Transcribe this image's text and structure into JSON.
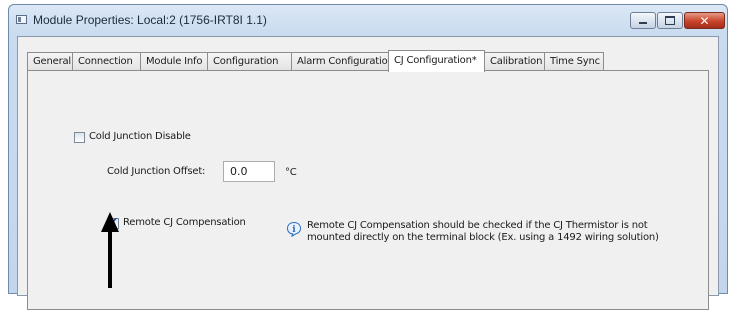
{
  "window": {
    "title": "Module Properties: Local:2 (1756-IRT8I 1.1)",
    "controls": {
      "minimize": "minimize",
      "maximize": "maximize",
      "close": "close"
    }
  },
  "tabs": [
    {
      "label": "General",
      "active": false
    },
    {
      "label": "Connection",
      "active": false
    },
    {
      "label": "Module Info",
      "active": false
    },
    {
      "label": "Configuration",
      "active": false
    },
    {
      "label": "Alarm Configuration",
      "active": false
    },
    {
      "label": "CJ Configuration*",
      "active": true
    },
    {
      "label": "Calibration",
      "active": false
    },
    {
      "label": "Time Sync",
      "active": false
    }
  ],
  "cj": {
    "disable_label": "Cold Junction Disable",
    "disable_checked": false,
    "offset_label": "Cold Junction Offset:",
    "offset_value": "0.0",
    "offset_unit": "°C",
    "remote_label": "Remote CJ Compensation",
    "remote_checked": true,
    "note_line1": "Remote CJ Compensation should be checked if the CJ Thermistor is not",
    "note_line2": "mounted directly on the terminal block (Ex. using a 1492 wiring solution)"
  },
  "icons": {
    "app": "window-app-icon",
    "info": "info-icon",
    "annotation": "up-arrow-icon"
  },
  "colors": {
    "titlebar": "#c9dbef",
    "close_button": "#c8442b",
    "panel_bg": "#f0f0f0",
    "check": "#1e3a8a",
    "info_icon": "#2b6cc4"
  }
}
